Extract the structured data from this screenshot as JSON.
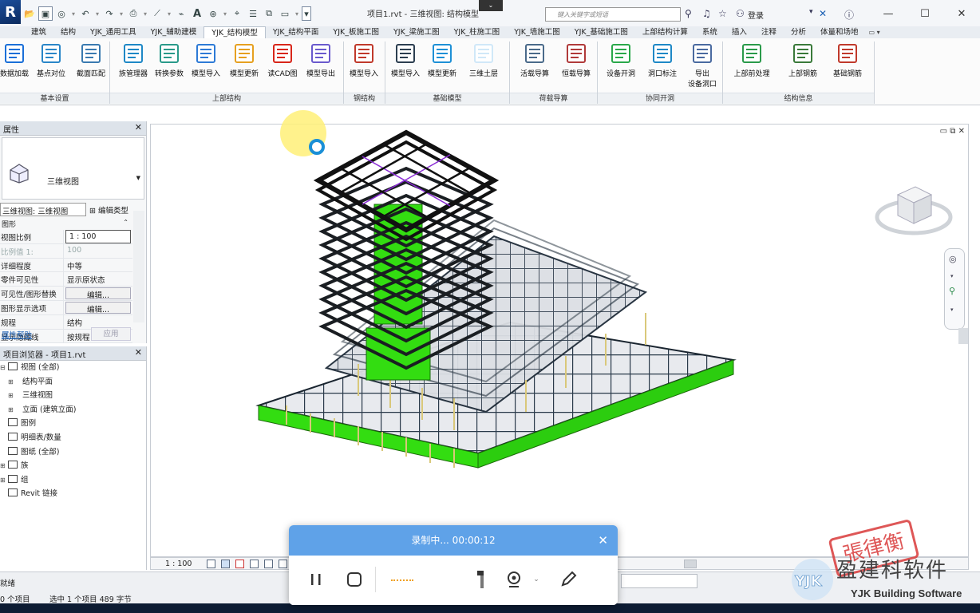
{
  "titlebar": {
    "doc_title": "项目1.rvt - 三维视图: 结构模型",
    "search_placeholder": "键入关键字或短语",
    "login_label": "登录",
    "minimize": "—",
    "maximize": "☐",
    "close": "✕"
  },
  "tabs": [
    "建筑",
    "结构",
    "YJK_通用工具",
    "YJK_辅助建模",
    "YJK_结构模型",
    "YJK_结构平面",
    "YJK_板施工图",
    "YJK_梁施工图",
    "YJK_柱施工图",
    "YJK_墙施工图",
    "YJK_基础施工图",
    "上部结构计算",
    "系统",
    "插入",
    "注释",
    "分析",
    "体量和场地"
  ],
  "active_tab": "YJK_结构模型",
  "ribbon": {
    "tools": [
      {
        "label": "数据加载",
        "icon": "data-load-icon"
      },
      {
        "label": "基点对位",
        "icon": "basepoint-align-icon"
      },
      {
        "label": "截面匹配",
        "icon": "section-match-icon"
      },
      {
        "label": "族管理器",
        "icon": "family-manager-icon"
      },
      {
        "label": "转换参数",
        "icon": "convert-params-icon"
      },
      {
        "label": "模型导入",
        "icon": "model-import-icon"
      },
      {
        "label": "模型更新",
        "icon": "model-update-icon"
      },
      {
        "label": "读CAD图",
        "icon": "read-cad-icon"
      },
      {
        "label": "模型导出",
        "icon": "model-export-icon"
      },
      {
        "label": "模型导入",
        "icon": "steel-model-import-icon"
      },
      {
        "label": "模型导入",
        "icon": "foundation-model-import-icon"
      },
      {
        "label": "模型更新",
        "icon": "foundation-model-update-icon"
      },
      {
        "label": "三维土层",
        "icon": "soil-3d-icon"
      },
      {
        "label": "活载导算",
        "icon": "live-load-icon"
      },
      {
        "label": "恒载导算",
        "icon": "dead-load-icon"
      },
      {
        "label": "设备开洞",
        "icon": "equipment-opening-icon"
      },
      {
        "label": "洞口标注",
        "icon": "opening-tag-icon"
      },
      {
        "label": "导出\n设备洞口",
        "icon": "export-opening-icon"
      },
      {
        "label": "上部前处理",
        "icon": "pre-process-icon"
      },
      {
        "label": "上部钢筋",
        "icon": "upper-rebar-icon"
      },
      {
        "label": "基础钢筋",
        "icon": "foundation-rebar-icon"
      }
    ],
    "groups": [
      "基本设置",
      "上部结构",
      "钢结构",
      "基础模型",
      "荷载导算",
      "协同开洞",
      "结构信息"
    ]
  },
  "properties": {
    "title": "属性",
    "type_name": "三维视图",
    "view_selector": "三维视图: 三维视图",
    "edit_type": "编辑类型",
    "category": "图形",
    "rows": [
      {
        "k": "视图比例",
        "v": "1 : 100",
        "style": "input"
      },
      {
        "k": "比例值 1:",
        "v": "100",
        "style": "dim"
      },
      {
        "k": "详细程度",
        "v": "中等",
        "style": ""
      },
      {
        "k": "零件可见性",
        "v": "显示原状态",
        "style": ""
      },
      {
        "k": "可见性/图形替换",
        "v": "编辑...",
        "style": "btn"
      },
      {
        "k": "图形显示选项",
        "v": "编辑...",
        "style": "btn"
      },
      {
        "k": "规程",
        "v": "结构",
        "style": ""
      },
      {
        "k": "显示隐藏线",
        "v": "按规程",
        "style": ""
      }
    ],
    "help": "属性帮助",
    "apply": "应用"
  },
  "browser": {
    "title": "项目浏览器 - 项目1.rvt",
    "nodes": [
      {
        "label": "视图 (全部)",
        "depth": 0,
        "ex": "⊟"
      },
      {
        "label": "结构平面",
        "depth": 1,
        "ex": "⊞"
      },
      {
        "label": "三维视图",
        "depth": 1,
        "ex": "⊞"
      },
      {
        "label": "立面 (建筑立面)",
        "depth": 1,
        "ex": "⊞"
      },
      {
        "label": "图例",
        "depth": 0,
        "ex": ""
      },
      {
        "label": "明细表/数量",
        "depth": 0,
        "ex": ""
      },
      {
        "label": "图纸 (全部)",
        "depth": 0,
        "ex": ""
      },
      {
        "label": "族",
        "depth": 0,
        "ex": "⊞"
      },
      {
        "label": "组",
        "depth": 0,
        "ex": "⊞"
      },
      {
        "label": "Revit 链接",
        "depth": 0,
        "ex": ""
      }
    ]
  },
  "viewbar": {
    "scale": "1 : 100"
  },
  "status": {
    "text": "就绪",
    "count": "0 个项目",
    "selection": "选中 1 个项目 489 字节"
  },
  "recorder": {
    "status": "录制中... 00:00:12",
    "close": "✕"
  },
  "watermark": {
    "name": "盈建科软件",
    "sub": "YJK Building Software",
    "seal": "張律衡",
    "logo_text": "YJK"
  },
  "colors": {
    "accent": "#5fa2e8",
    "model_green": "#33dd11",
    "model_purple": "#8a2bd6"
  }
}
